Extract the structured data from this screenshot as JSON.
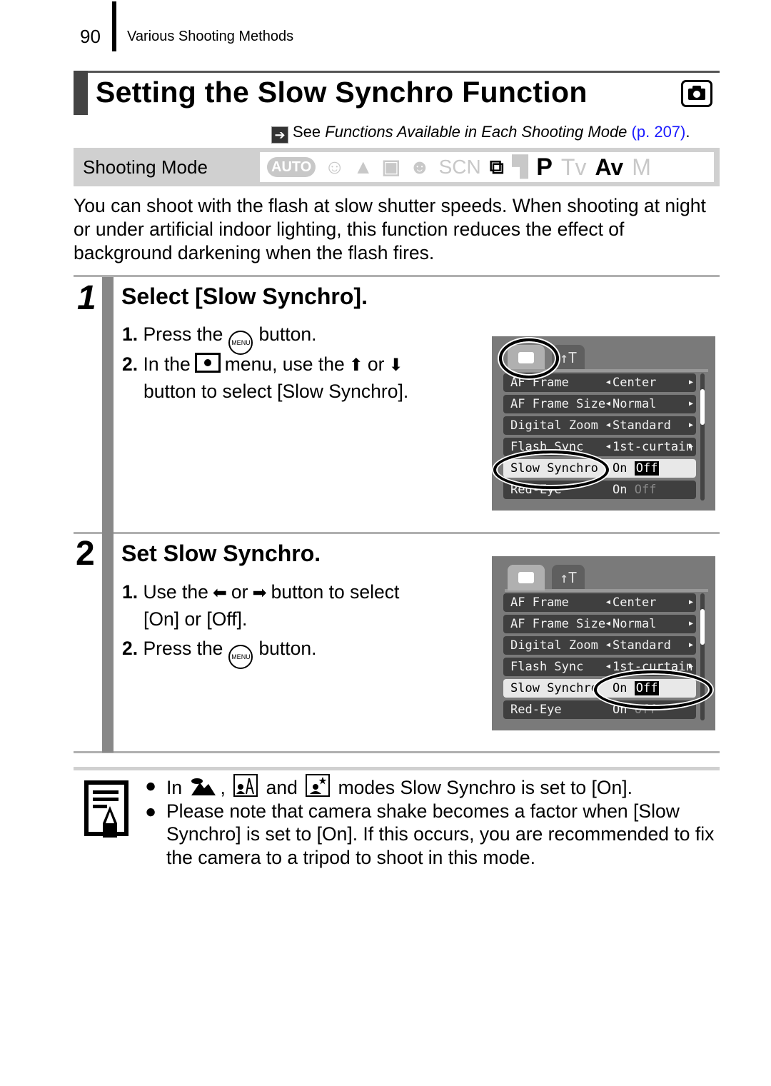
{
  "header": {
    "page_number": "90",
    "section": "Various Shooting Methods"
  },
  "title": "Setting the Slow Synchro Function",
  "title_icon": "camera-mode-icon",
  "see_also": {
    "prefix": "See ",
    "italic": "Functions Available in Each Shooting Mode",
    "link": "(p. 207)",
    "suffix": "."
  },
  "shooting_mode": {
    "label": "Shooting Mode",
    "modes": [
      {
        "name": "AUTO",
        "enabled": false
      },
      {
        "name": "Portrait",
        "enabled": false
      },
      {
        "name": "Landscape",
        "enabled": false
      },
      {
        "name": "Night Snapshot",
        "enabled": false
      },
      {
        "name": "Kids & Pets",
        "enabled": false
      },
      {
        "name": "SCN",
        "enabled": false
      },
      {
        "name": "Stitch Assist",
        "enabled": true
      },
      {
        "name": "Movie",
        "enabled": false
      },
      {
        "name": "P",
        "enabled": true
      },
      {
        "name": "Tv",
        "enabled": false
      },
      {
        "name": "Av",
        "enabled": true
      },
      {
        "name": "M",
        "enabled": false
      }
    ]
  },
  "intro": "You can shoot with the flash at slow shutter speeds. When shooting at night or under artificial indoor lighting, this function reduces the effect of background darkening when the flash fires.",
  "steps": [
    {
      "number": "1",
      "title": "Select [Slow Synchro].",
      "i1_num": "1.",
      "i1_a": "Press the",
      "i1_b": "button.",
      "i2_num": "2.",
      "i2_a": "In the",
      "i2_b": "menu, use the",
      "i2_c": "or",
      "i2_d": "button to select [Slow Synchro].",
      "up_arrow": "⬆",
      "down_arrow": "⬇"
    },
    {
      "number": "2",
      "title": "Set Slow Synchro.",
      "i1_num": "1.",
      "i1_a": "Use the",
      "i1_b": "or",
      "i1_c": "button to select",
      "i1_d": "[On] or [Off].",
      "i2_num": "2.",
      "i2_a": "Press the",
      "i2_b": "button.",
      "left_arrow": "⬅",
      "right_arrow": "➡"
    }
  ],
  "menu_button_label": "MENU",
  "lcd": {
    "tools_tab": "↑T",
    "rows": [
      {
        "label": "AF Frame",
        "value": "Center"
      },
      {
        "label": "AF Frame Size",
        "value": "Normal"
      },
      {
        "label": "Digital Zoom",
        "value": "Standard"
      },
      {
        "label": "Flash Sync",
        "value": "1st-curtain"
      },
      {
        "label": "Slow Synchro",
        "on": "On",
        "off": "Off"
      },
      {
        "label": "Red-Eye",
        "on": "On",
        "off": "Off"
      }
    ]
  },
  "note": {
    "b1_a": "In",
    "b1_b": ",",
    "b1_c": "and",
    "b1_d": "modes Slow Synchro is set to [On].",
    "b2": "Please note that camera shake becomes a factor when [Slow Synchro] is set to [On]. If this occurs, you are recommended to fix the camera to a tripod to shoot in this mode.",
    "bullet": "●"
  }
}
